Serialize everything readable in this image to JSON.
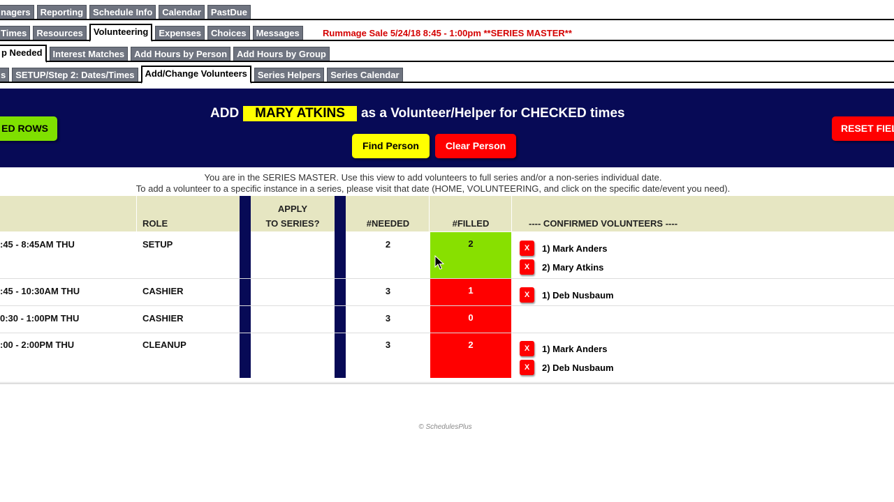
{
  "tabs": {
    "row1": [
      "nagers",
      "Reporting",
      "Schedule Info",
      "Calendar",
      "PastDue"
    ],
    "row2": [
      "Times",
      "Resources",
      "Volunteering",
      "Expenses",
      "Choices",
      "Messages"
    ],
    "row3": [
      "p Needed",
      "Interest Matches",
      "Add Hours by Person",
      "Add Hours by Group"
    ],
    "row4": [
      "s",
      "SETUP/Step 2: Dates/Times",
      "Add/Change Volunteers",
      "Series Helpers",
      "Series Calendar"
    ]
  },
  "series_title": "Rummage Sale 5/24/18 8:45 - 1:00pm **SERIES MASTER**",
  "banner": {
    "add_label": "ADD",
    "person_name": "MARY ATKINS",
    "suffix": "as a Volunteer/Helper for CHECKED times",
    "checked_rows_button": "ED ROWS",
    "find_button": "Find Person",
    "clear_button": "Clear Person",
    "reset_button": "RESET FIEL"
  },
  "info": {
    "line1": "You are in the SERIES MASTER. Use this view to add volunteers to full series and/or a non-series individual date.",
    "line2": "To add a volunteer to a specific instance in a series, please visit that date (HOME, VOLUNTEERING, and click on the specific date/event you need)."
  },
  "table": {
    "headers": {
      "role": "ROLE",
      "apply_line1": "APPLY",
      "apply_line2": "TO SERIES?",
      "needed": "#NEEDED",
      "filled": "#FILLED",
      "confirmed": "---- CONFIRMED VOLUNTEERS ----"
    },
    "rows": [
      {
        "time": ":45 - 8:45AM THU",
        "role": "SETUP",
        "needed": "2",
        "filled": "2",
        "status": "full",
        "volunteers": [
          "1) Mark Anders",
          "2) Mary Atkins"
        ]
      },
      {
        "time": ":45 - 10:30AM THU",
        "role": "CASHIER",
        "needed": "3",
        "filled": "1",
        "status": "short",
        "volunteers": [
          "1) Deb Nusbaum"
        ]
      },
      {
        "time": "0:30 - 1:00PM THU",
        "role": "CASHIER",
        "needed": "3",
        "filled": "0",
        "status": "short",
        "volunteers": []
      },
      {
        "time": ":00 - 2:00PM THU",
        "role": "CLEANUP",
        "needed": "3",
        "filled": "2",
        "status": "short",
        "volunteers": [
          "1) Mark Anders",
          "2) Deb Nusbaum"
        ]
      }
    ]
  },
  "remove_label": "X",
  "colors": {
    "navy": "#070a56",
    "full": "#88e000",
    "short": "#ff0000",
    "highlight": "#ffff00"
  },
  "footer": "© SchedulesPlus"
}
